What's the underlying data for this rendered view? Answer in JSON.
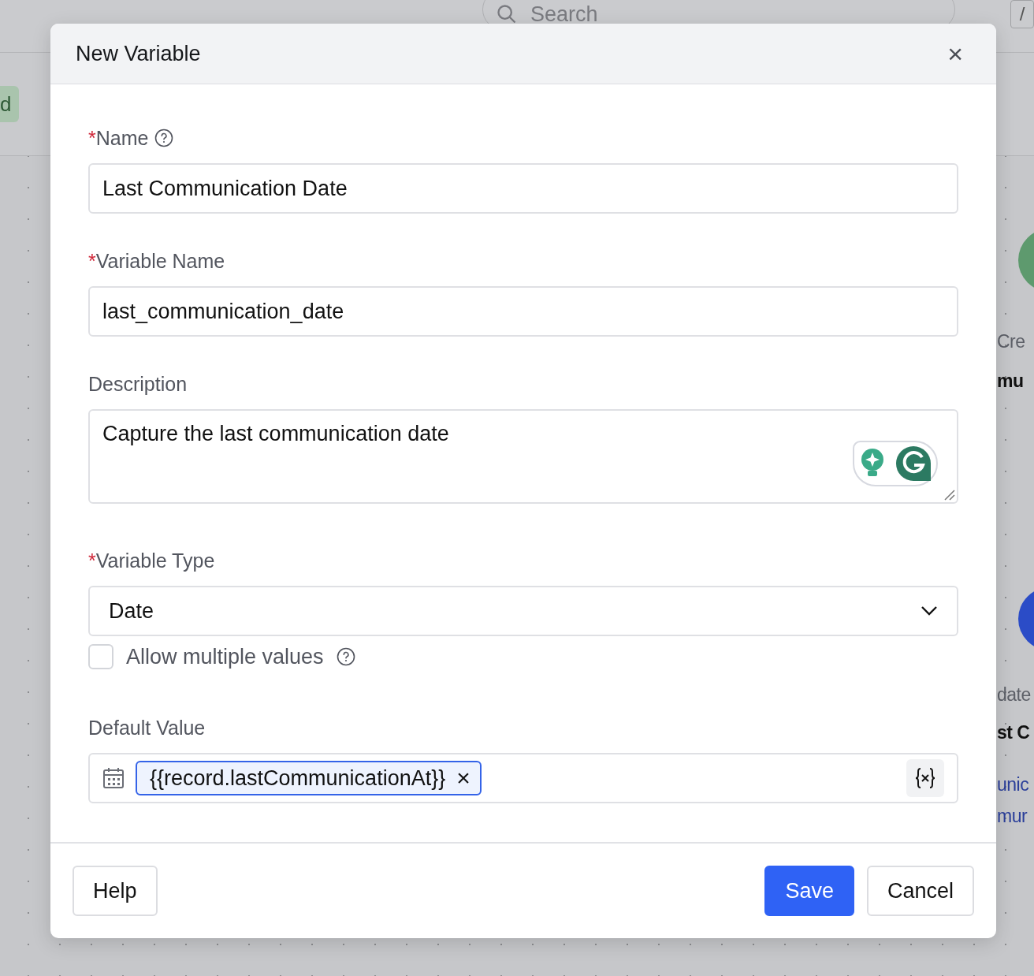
{
  "backdrop": {
    "search": {
      "placeholder": "Search"
    },
    "shortcut_key": "/",
    "badge": "d",
    "fragments": [
      {
        "text": "Cre",
        "kind": "label"
      },
      {
        "text": "mu",
        "kind": "title"
      },
      {
        "text": "date",
        "kind": "label"
      },
      {
        "text": "st C",
        "kind": "title"
      },
      {
        "text": "unic",
        "kind": "link"
      },
      {
        "text": "mur",
        "kind": "link"
      }
    ]
  },
  "dialog": {
    "title": "New Variable",
    "close": "×",
    "fields": [
      {
        "kind": "text",
        "label": "Name",
        "required_mark": "*",
        "help": true,
        "value": "Last Communication Date"
      },
      {
        "kind": "text",
        "label": "Variable Name",
        "required_mark": "*",
        "value": "last_communication_date"
      },
      {
        "kind": "textarea",
        "label": "Description",
        "value": "Capture the last communication date"
      },
      {
        "kind": "select",
        "label": "Variable Type",
        "required_mark": "*",
        "value": "Date"
      },
      {
        "kind": "checkbox",
        "label": "Allow multiple values",
        "checked": false,
        "help": true
      },
      {
        "kind": "token",
        "label": "Default Value",
        "token": "{{record.lastCommunicationAt}}",
        "token_remove": "×"
      }
    ],
    "footer": {
      "help": "Help",
      "save": "Save",
      "cancel": "Cancel"
    }
  }
}
